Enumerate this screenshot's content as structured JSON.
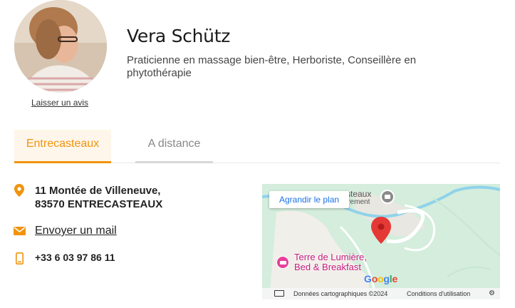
{
  "profile": {
    "name": "Vera Schütz",
    "subtitle": "Praticienne en massage bien-être, Herboriste, Conseillère en phytothérapie",
    "review_link": "Laisser un avis"
  },
  "tabs": [
    {
      "label": "Entrecasteaux",
      "active": true
    },
    {
      "label": "A distance",
      "active": false
    }
  ],
  "contact": {
    "address_line1": "11 Montée de Villeneuve,",
    "address_line2": "83570 ENTRECASTEAUX",
    "mail_label": "Envoyer un mail",
    "phone": "+33 6 03 97 86 11",
    "icons": [
      "map-pin-icon",
      "envelope-icon",
      "phone-icon"
    ]
  },
  "map": {
    "expand_button": "Agrandir le plan",
    "top_label": "steaux",
    "top_label2": "irement",
    "place_line1": "Terre de Lumière,",
    "place_line2": "Bed & Breakfast",
    "google_logo": "Google",
    "footer_data": "Données cartographiques ©2024",
    "footer_terms": "Conditions d'utilisation"
  },
  "colors": {
    "accent": "#f0940e",
    "map_pin": "#e53935",
    "map_place": "#c5197d",
    "map_link": "#1a73e8"
  }
}
